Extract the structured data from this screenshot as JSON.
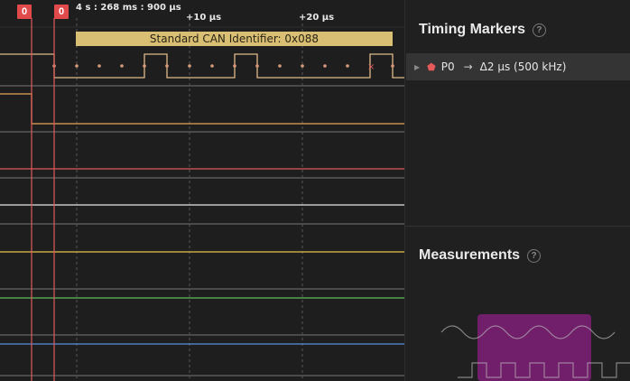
{
  "markers": {
    "flag_left": "0",
    "flag_right": "0"
  },
  "time_labels": {
    "absolute": "4 s : 268 ms : 900 µs",
    "plus10": "+10 µs",
    "plus20": "+20 µs"
  },
  "decoder": {
    "can_identifier": "Standard CAN Identifier: 0x088"
  },
  "channel_colors": {
    "ch0": "#e0ba8a",
    "ch1": "#e8a45c",
    "ch2": "#e05a5a",
    "ch3": "#e6e6e6",
    "ch4": "#e8c24a",
    "ch5": "#5fbf5f",
    "ch6": "#5a8fe0"
  },
  "timing_markers": {
    "title": "Timing Markers",
    "help": "?",
    "row": {
      "name": "P0",
      "arrow": "→",
      "delta": "Δ2 µs (500 kHz)"
    }
  },
  "measurements": {
    "title": "Measurements",
    "help": "?"
  }
}
